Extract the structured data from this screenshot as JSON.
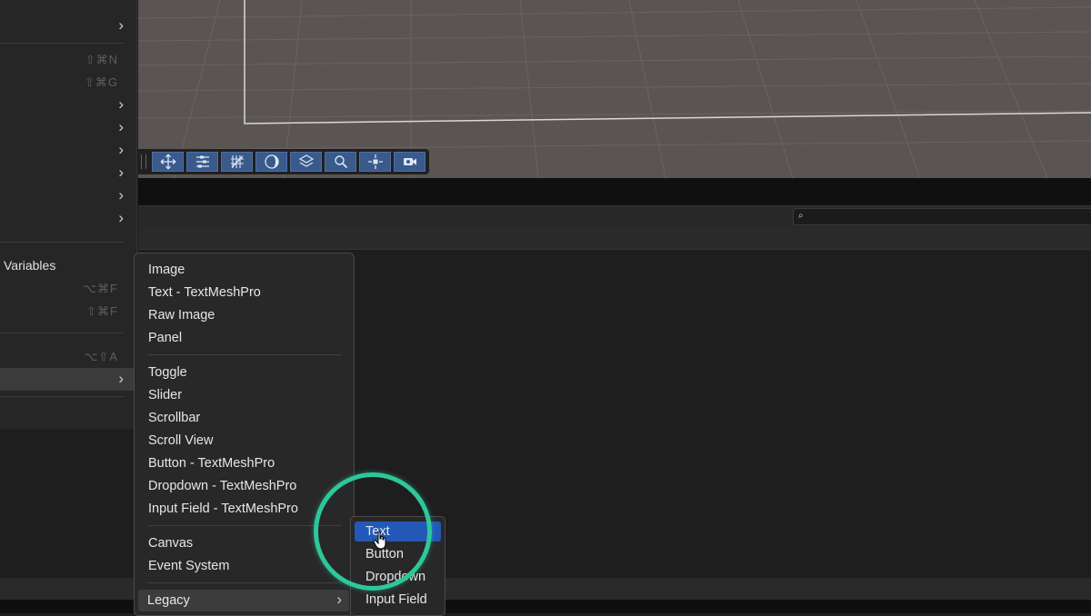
{
  "left_menu": {
    "rows": [
      {
        "label": "",
        "shortcut": "",
        "submenu": true
      },
      {
        "label": "",
        "shortcut": "⇧⌘N",
        "submenu": false
      },
      {
        "label": "",
        "shortcut": "⇧⌘G",
        "submenu": false
      },
      {
        "label": "",
        "shortcut": "",
        "submenu": true
      },
      {
        "label": "",
        "shortcut": "",
        "submenu": true
      },
      {
        "label": "",
        "shortcut": "",
        "submenu": true
      },
      {
        "label": "",
        "shortcut": "",
        "submenu": true
      },
      {
        "label": "",
        "shortcut": "",
        "submenu": true
      },
      {
        "label": "",
        "shortcut": "",
        "submenu": true
      },
      {
        "label": "Variables",
        "shortcut": "",
        "submenu": false
      },
      {
        "label": "",
        "shortcut": "⌥⌘F",
        "submenu": false
      },
      {
        "label": "",
        "shortcut": "⇧⌘F",
        "submenu": false
      },
      {
        "label": "",
        "shortcut": "⌥⇧A",
        "submenu": false
      },
      {
        "label": "",
        "shortcut": "",
        "submenu": true
      }
    ]
  },
  "scene_toolbar": {
    "tools": [
      "move-tool-icon",
      "rect-tool-icon",
      "grid-snap-icon",
      "shading-icon",
      "layers-icon",
      "zoom-icon",
      "transform-icon",
      "camera-icon"
    ]
  },
  "project_search": {
    "placeholder": ""
  },
  "context_menu": {
    "group1": [
      "Image",
      "Text - TextMeshPro",
      "Raw Image",
      "Panel"
    ],
    "group2": [
      "Toggle",
      "Slider",
      "Scrollbar",
      "Scroll View",
      "Button - TextMeshPro",
      "Dropdown - TextMeshPro",
      "Input Field - TextMeshPro"
    ],
    "group3": [
      "Canvas",
      "Event System"
    ],
    "legacy_label": "Legacy"
  },
  "submenu": {
    "items": [
      "Text",
      "Button",
      "Dropdown",
      "Input Field"
    ],
    "highlighted": "Text"
  },
  "colors": {
    "highlight": "#2358b8",
    "ring": "#2ec79a",
    "tool_button": "#3a5a8c"
  }
}
